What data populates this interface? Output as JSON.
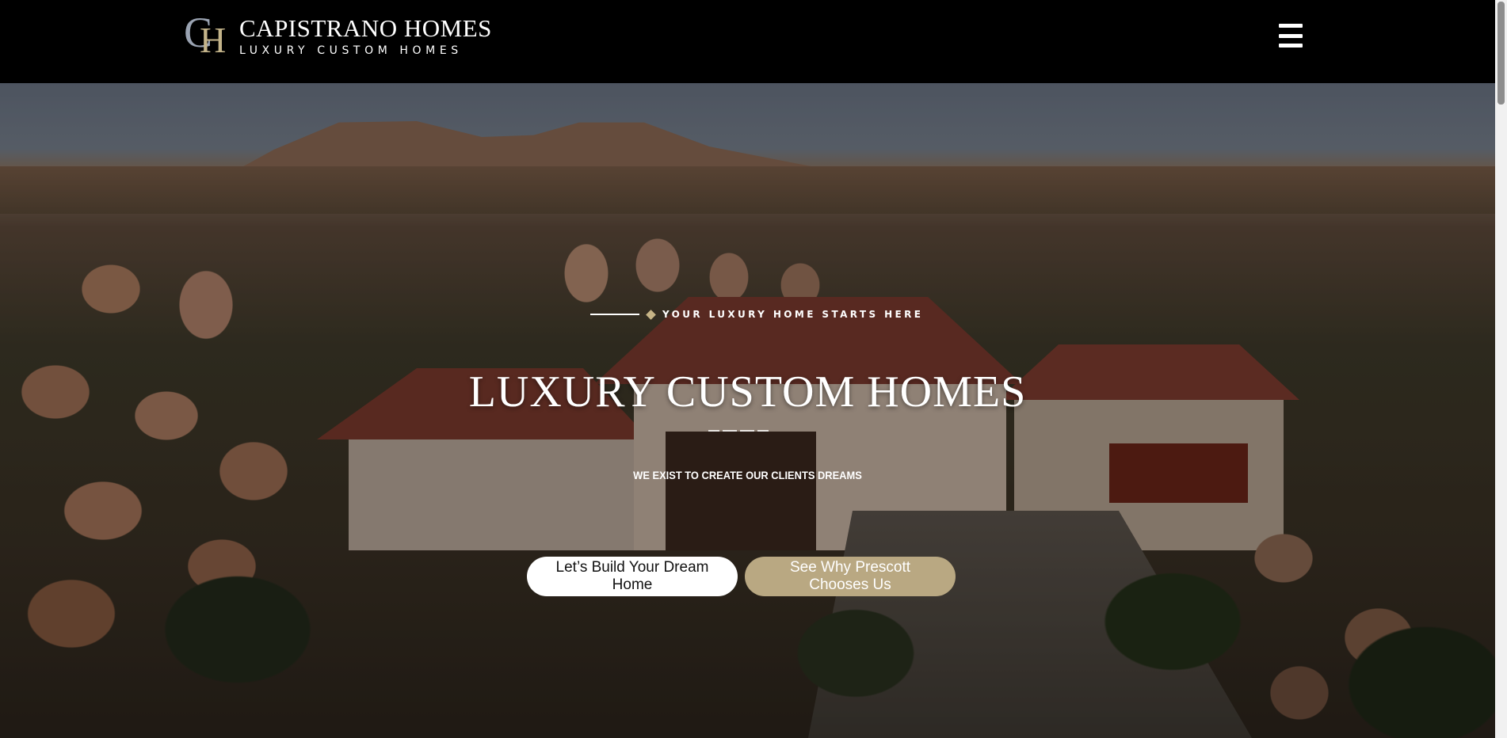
{
  "header": {
    "logo": {
      "mark_letters": [
        "C",
        "H"
      ],
      "title": "CAPISTRANO HOMES",
      "tagline": "LUXURY CUSTOM HOMES"
    },
    "menu_icon": "hamburger-icon"
  },
  "hero": {
    "eyebrow": "YOUR LUXURY HOME STARTS HERE",
    "title": "LUXURY CUSTOM HOMES",
    "subtitle": "WE EXIST TO CREATE OUR CLIENTS DREAMS",
    "buttons": {
      "primary": "Let’s Build Your Dream Home",
      "secondary": "See Why Prescott Chooses Us"
    }
  },
  "colors": {
    "accent": "#c7b486",
    "secondary_button": "#b9a882",
    "header_bg": "#000000"
  }
}
